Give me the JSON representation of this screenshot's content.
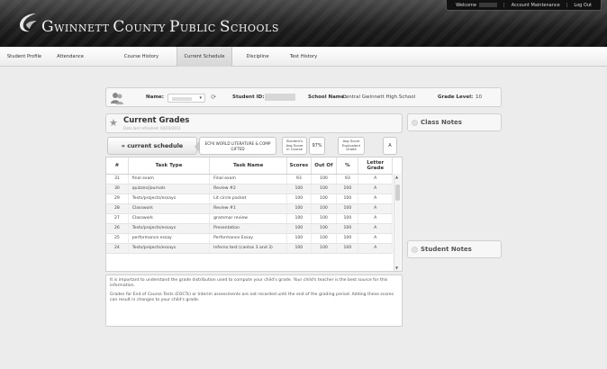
{
  "header": {
    "title_part1": "G",
    "title_part2": "winnett ",
    "title_part3": "C",
    "title_part4": "ounty ",
    "title_part5": "P",
    "title_part6": "ublic ",
    "title_part7": "S",
    "title_part8": "chools",
    "welcome": "Welcome",
    "account": "Account Maintenance",
    "logout": "Log Out"
  },
  "nav": {
    "tabs": [
      "Student Profile",
      "Attendance",
      "Course History",
      "Current Schedule",
      "Discipline",
      "Test History"
    ],
    "active": "Current Schedule"
  },
  "student": {
    "name_label": "Name:",
    "id_label": "Student ID:",
    "school_label": "School Name:",
    "school_value": "Central Gwinnett High School",
    "grade_label": "Grade Level:",
    "grade_value": "10"
  },
  "grades": {
    "title": "Current Grades",
    "subtitle": "Data last refreshed: 04/19/2011",
    "back_button": "« current schedule",
    "course_line1": "ECP4 WORLD LITERATURE & COMP",
    "course_line2": "GIFTED",
    "avg_label_1": "Student's",
    "avg_label_2": "Avg Score",
    "avg_label_3": "in Course",
    "avg_value": "97%",
    "letter_label_1": "Avg Score",
    "letter_label_2": "Equivalent",
    "letter_label_3": "Grade",
    "letter_value": "A"
  },
  "table": {
    "headers": [
      "#",
      "Task Type",
      "Task Name",
      "Scores",
      "Out Of",
      "%",
      "Letter Grade"
    ],
    "rows": [
      [
        "31",
        "final exam",
        "Final exam",
        "93",
        "100",
        "93",
        "A"
      ],
      [
        "30",
        "quizzes/journals",
        "Review #2",
        "100",
        "100",
        "100",
        "A"
      ],
      [
        "29",
        "Tests/projects/essays",
        "Lit circle packet",
        "100",
        "100",
        "100",
        "A"
      ],
      [
        "28",
        "Classwork",
        "Review #1",
        "100",
        "100",
        "100",
        "A"
      ],
      [
        "27",
        "Classwork",
        "grammar review",
        "100",
        "100",
        "100",
        "A"
      ],
      [
        "26",
        "Tests/projects/essays",
        "Presentation",
        "100",
        "100",
        "100",
        "A"
      ],
      [
        "25",
        "performance essay",
        "Performance Essay",
        "100",
        "100",
        "100",
        "A"
      ],
      [
        "24",
        "Tests/projects/essays",
        "Inferno test (cantos 3 and 3)",
        "100",
        "100",
        "100",
        "A"
      ]
    ]
  },
  "note": {
    "p1": "It is important to understand the grade distribution used to compute your child's grade. Your child's teacher is the best source for this information.",
    "p2": "Grades for End of Course Tests (EOCTs) or Interim assessments are not recorded until the end of the grading period. Adding these scores can result in changes to your child's grade."
  },
  "side": {
    "class_notes": "Class Notes",
    "student_notes": "Student Notes"
  }
}
